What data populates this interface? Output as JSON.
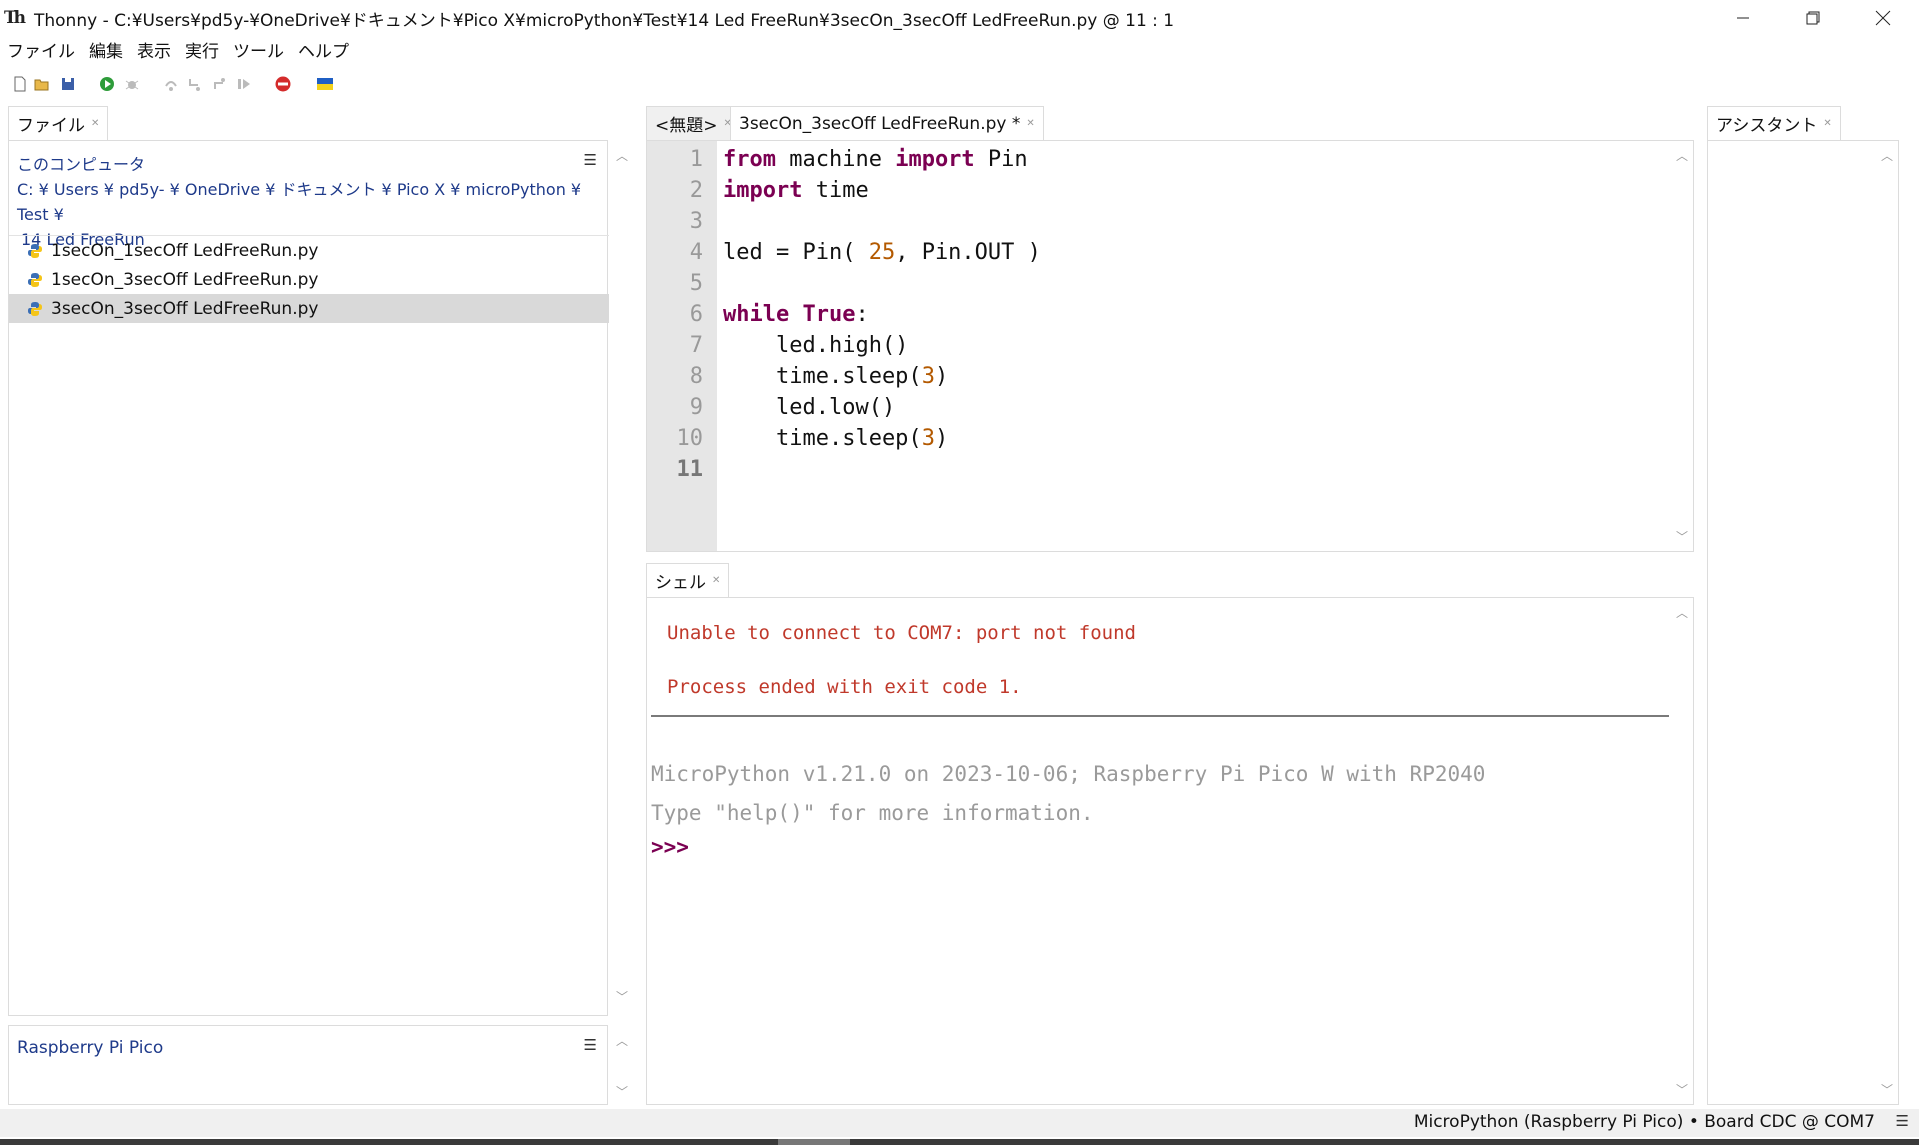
{
  "window": {
    "title": "Thonny  -  C:¥Users¥pd5y-¥OneDrive¥ドキュメント¥Pico X¥microPython¥Test¥14 Led FreeRun¥3secOn_3secOff LedFreeRun.py  @  11 : 1",
    "logo": "Th"
  },
  "menu": [
    "ファイル",
    "編集",
    "表示",
    "実行",
    "ツール",
    "ヘルプ"
  ],
  "toolbar_icons": [
    "new-file-icon",
    "open-file-icon",
    "save-icon",
    "run-icon",
    "debug-icon",
    "step-over-icon",
    "step-into-icon",
    "step-out-icon",
    "resume-icon",
    "stop-icon",
    "ukraine-flag-icon"
  ],
  "files": {
    "tab_label": "ファイル",
    "computer_header": "このコンピュータ",
    "path_line1": "C: ¥ Users ¥ pd5y- ¥ OneDrive ¥ ドキュメント ¥ Pico X ¥ microPython ¥ Test ¥",
    "path_line2": "14 Led FreeRun",
    "items": [
      {
        "name": "1secOn_1secOff LedFreeRun.py",
        "selected": false
      },
      {
        "name": "1secOn_3secOff LedFreeRun.py",
        "selected": false
      },
      {
        "name": "3secOn_3secOff LedFreeRun.py",
        "selected": true
      }
    ],
    "device_header": "Raspberry Pi Pico"
  },
  "editor": {
    "tabs": [
      {
        "label": "<無題>",
        "active": false
      },
      {
        "label": "3secOn_3secOff LedFreeRun.py *",
        "active": true
      }
    ],
    "line_numbers": [
      "1",
      "2",
      "3",
      "4",
      "5",
      "6",
      "7",
      "8",
      "9",
      "10",
      "11"
    ],
    "code": {
      "l1_kw1": "from",
      "l1_mid": " machine ",
      "l1_kw2": "import",
      "l1_end": " Pin",
      "l2_kw": "import",
      "l2_end": " time",
      "l4_start": "led = Pin( ",
      "l4_num": "25",
      "l4_end": ", Pin.OUT )",
      "l6_kw1": "while",
      "l6_sp": " ",
      "l6_kw2": "True",
      "l6_end": ":",
      "l7": "    led.high()",
      "l8_start": "    time.sleep(",
      "l8_num": "3",
      "l8_end": ")",
      "l9": "    led.low()",
      "l10_start": "    time.sleep(",
      "l10_num": "3",
      "l10_end": ")"
    }
  },
  "shell": {
    "tab_label": "シェル",
    "error_line1": "Unable to connect to COM7: port not found",
    "error_line2": "Process ended with exit code 1.",
    "info_line1": "MicroPython v1.21.0 on 2023-10-06; Raspberry Pi Pico W with RP2040",
    "info_line2": "Type \"help()\" for more information.",
    "prompt": ">>>"
  },
  "assistant": {
    "tab_label": "アシスタント"
  },
  "statusbar": {
    "text": "MicroPython (Raspberry Pi Pico)  •  Board CDC @ COM7"
  },
  "colors": {
    "keyword": "#7b0052",
    "number": "#b35900",
    "error": "#c0392b",
    "link": "#1e3a8a"
  }
}
